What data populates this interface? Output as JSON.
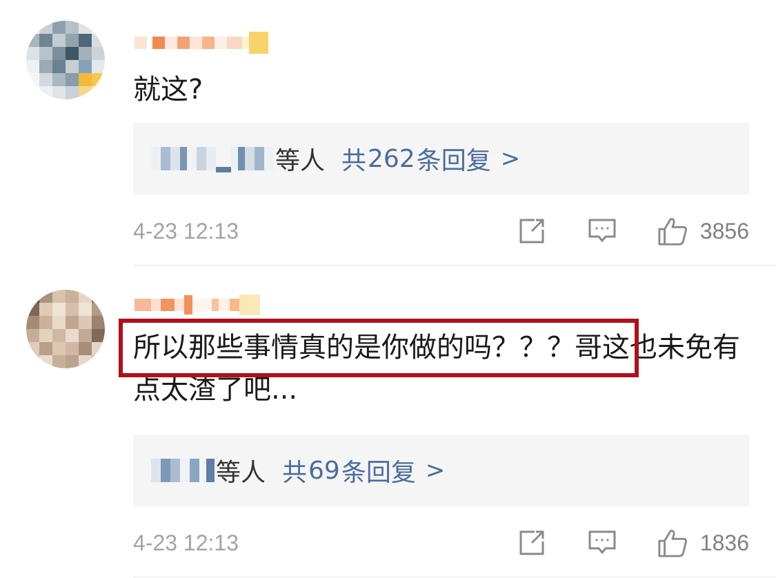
{
  "comments": [
    {
      "text": "就这?",
      "replies": {
        "suffix": "等人",
        "prefix": "共",
        "count": "262",
        "unit": "条回复",
        "chevron": ">"
      },
      "timestamp": "4-23 12:13",
      "likes": "3856",
      "icons": [
        "share-icon",
        "comment-icon",
        "like-icon"
      ]
    },
    {
      "text_highlighted": "所以那些事情真的是你做的吗？？？",
      "text_rest": "哥这也未免有点太渣了吧...",
      "replies": {
        "suffix": "等人",
        "prefix": "共",
        "count": "69",
        "unit": "条回复",
        "chevron": ">"
      },
      "timestamp": "4-23 12:13",
      "likes": "1836",
      "icons": [
        "share-icon",
        "comment-icon",
        "like-icon"
      ]
    }
  ],
  "colors": {
    "link": "#4b6c9c",
    "highlight_border": "#b0101a",
    "meta": "#a3a3a3",
    "reply_bg": "#f5f5f5"
  }
}
